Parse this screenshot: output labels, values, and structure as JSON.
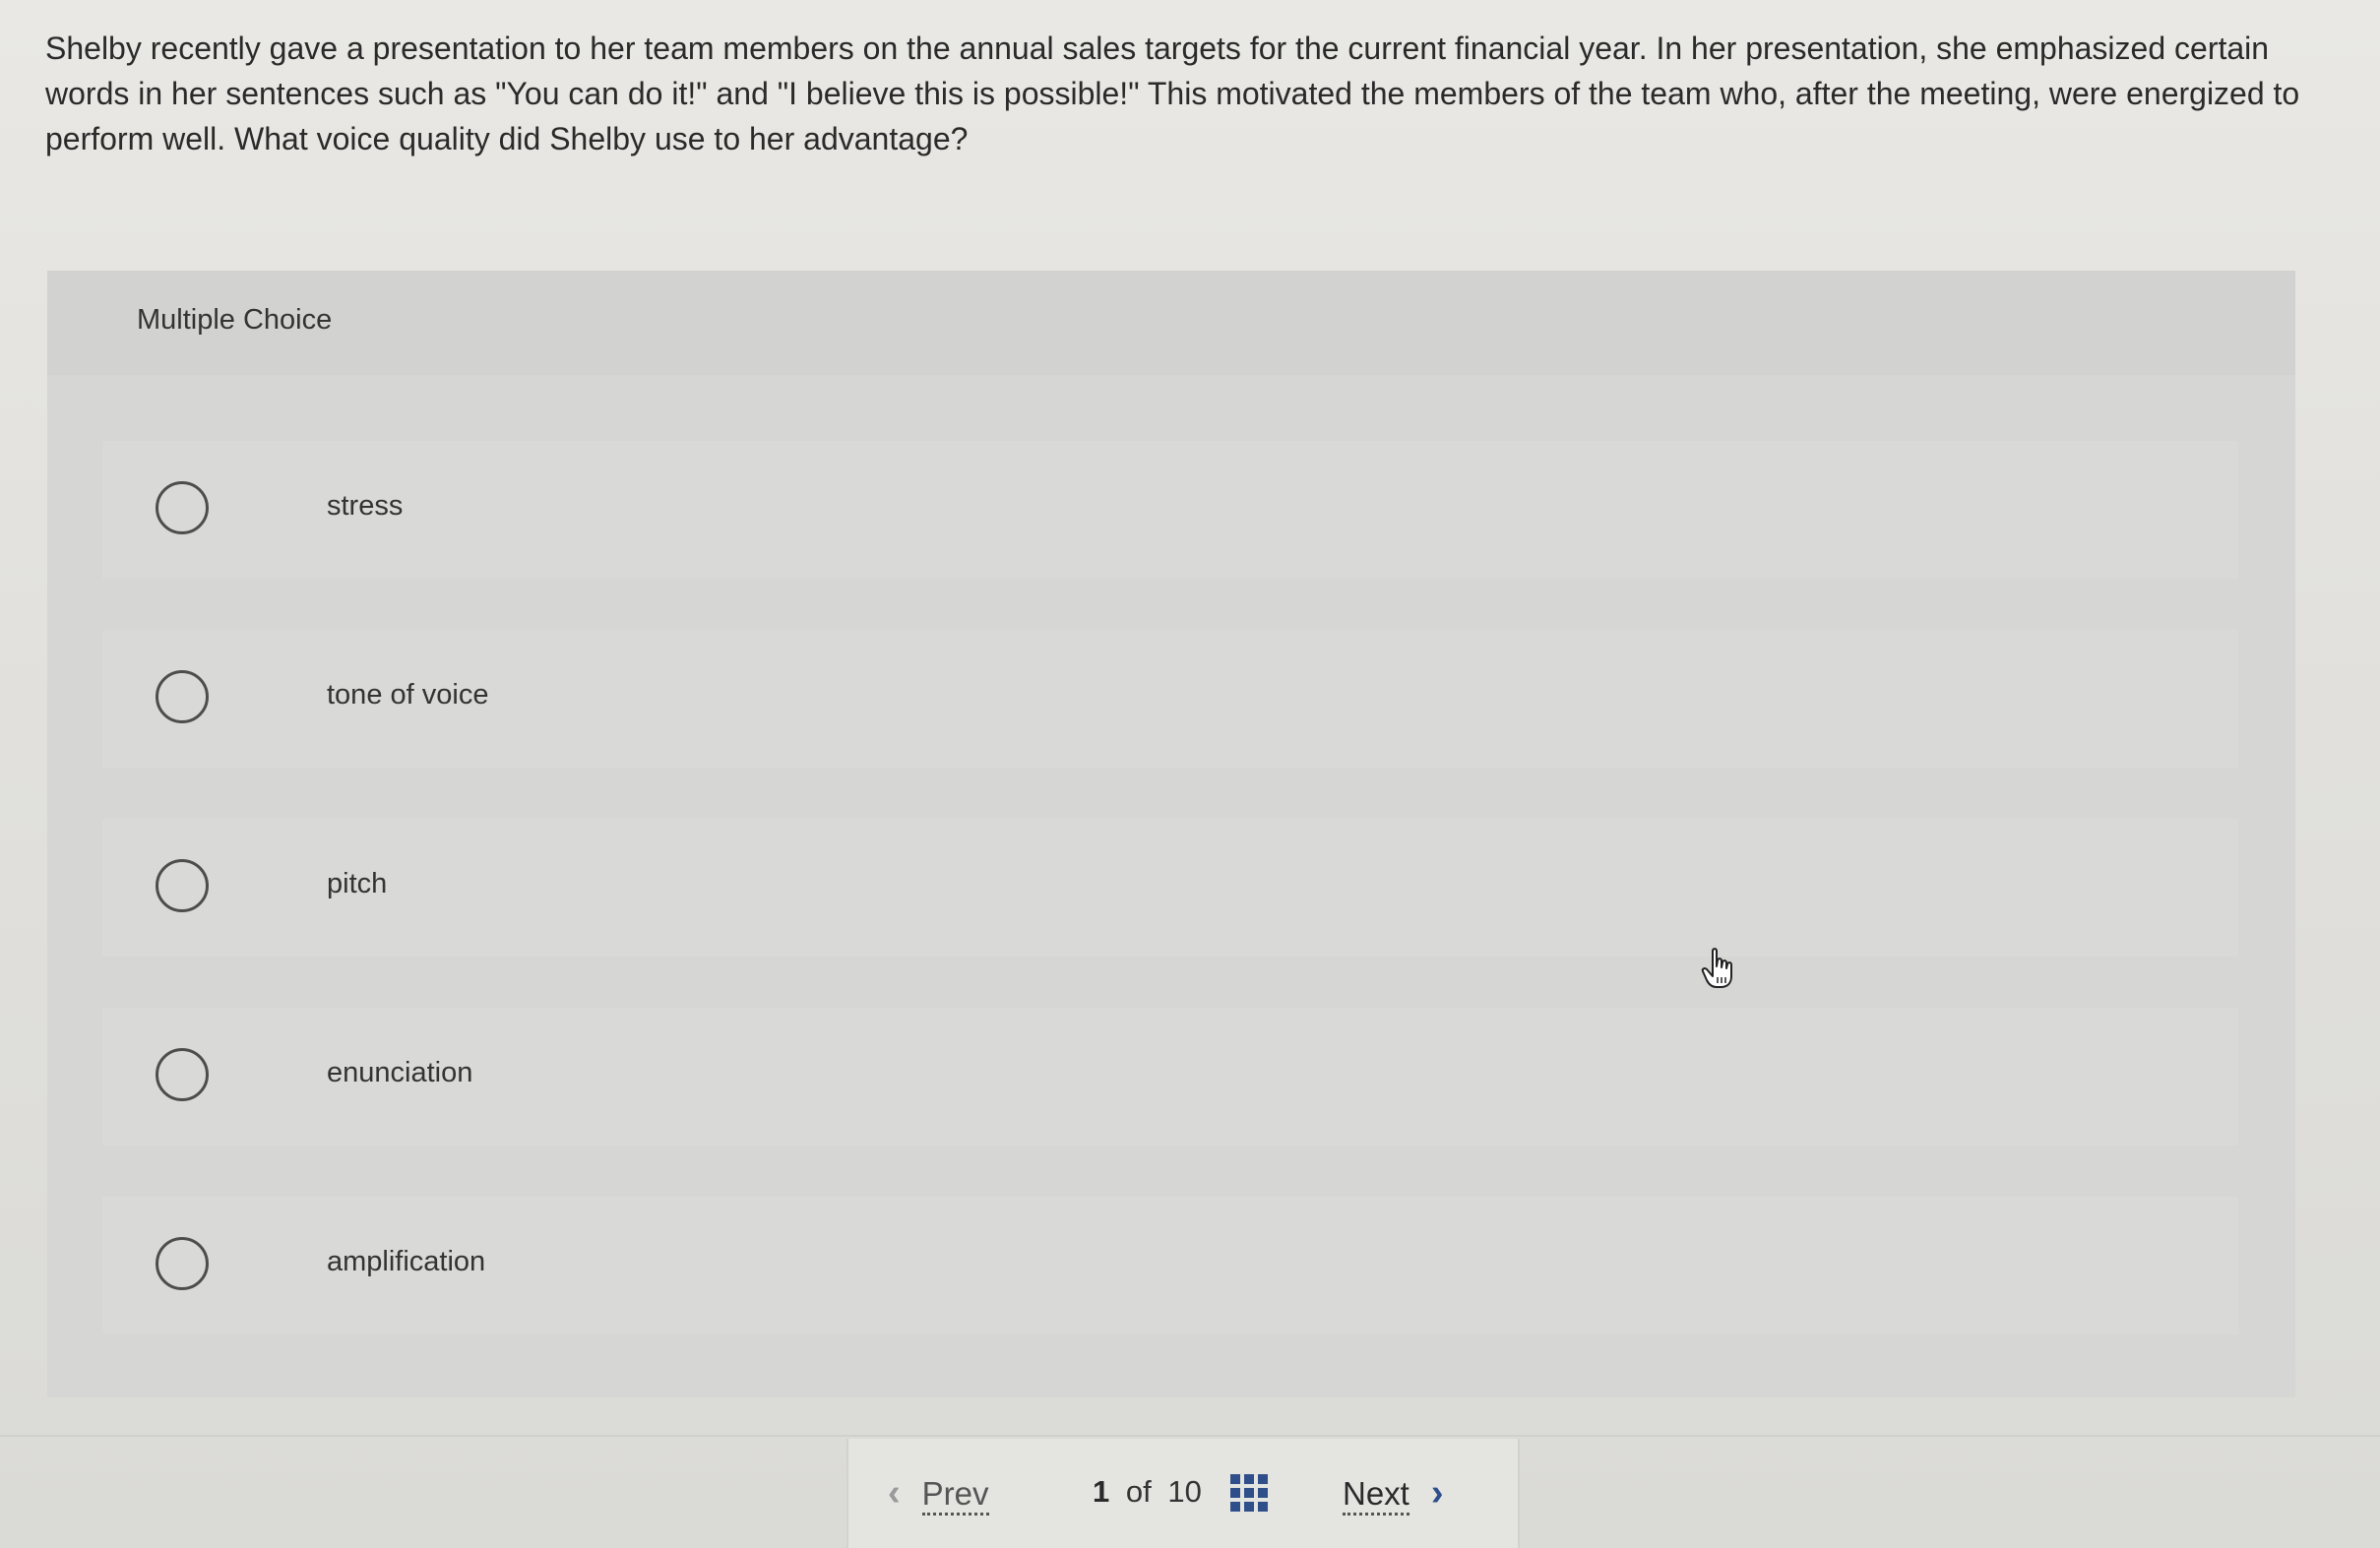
{
  "question": {
    "text": "Shelby recently gave a presentation to her team members on the annual sales targets for the current financial year. In her presentation, she emphasized certain words in her sentences such as \"You can do it!\" and \"I believe this is possible!\" This motivated the members of the team who, after the meeting, were energized to perform well. What voice quality did Shelby use to her advantage?"
  },
  "panel": {
    "label": "Multiple Choice"
  },
  "choices": [
    {
      "label": "stress",
      "selected": false
    },
    {
      "label": "tone of voice",
      "selected": false
    },
    {
      "label": "pitch",
      "selected": false
    },
    {
      "label": "enunciation",
      "selected": false
    },
    {
      "label": "amplification",
      "selected": false
    }
  ],
  "nav": {
    "prev_label": "Prev",
    "prev_icon": "chevron-left-icon",
    "current": "1",
    "of_label": "of",
    "total": "10",
    "grid_icon": "question-grid-icon",
    "next_label": "Next",
    "next_icon": "chevron-right-icon"
  },
  "colors": {
    "accent": "#2f4f8a",
    "text": "#2a2a2a"
  }
}
